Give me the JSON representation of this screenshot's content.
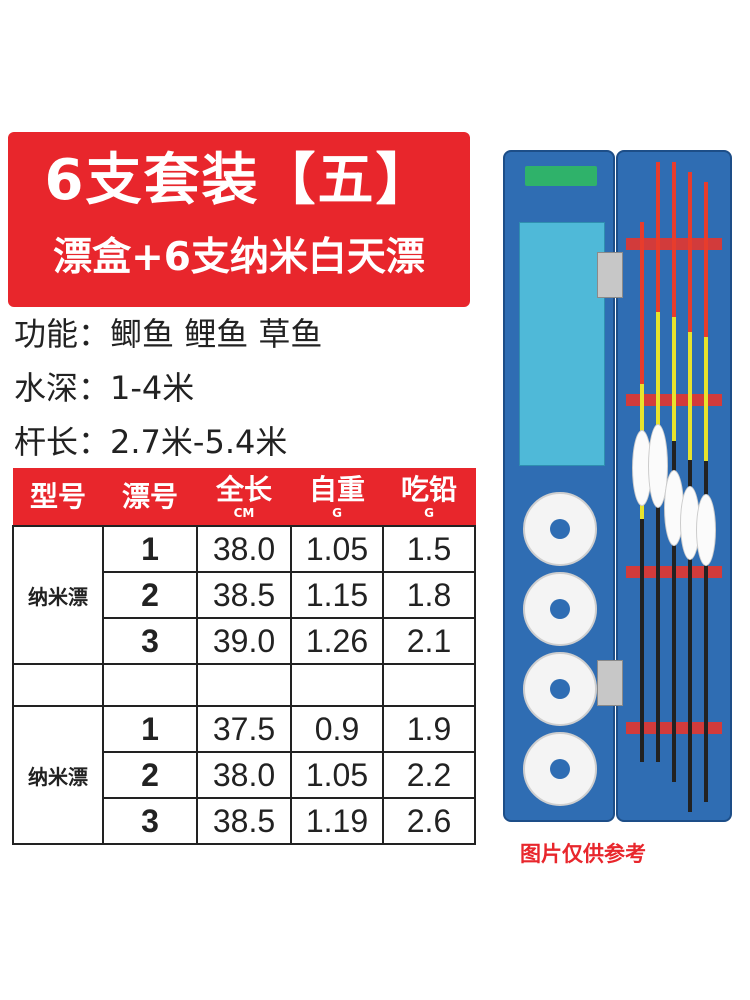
{
  "banner": {
    "line1": "6支套装【五】",
    "line2": "漂盒+6支纳米白天漂"
  },
  "specs": [
    {
      "label": "功能：",
      "value": "鲫鱼 鲤鱼 草鱼"
    },
    {
      "label": "水深：",
      "value": "1-4米"
    },
    {
      "label": "杆长：",
      "value": "2.7米-5.4米"
    }
  ],
  "table": {
    "headers": {
      "type": "型号",
      "index": "漂号",
      "length": "全长",
      "length_unit": "CM",
      "weight": "自重",
      "weight_unit": "G",
      "lead": "吃铅",
      "lead_unit": "G"
    },
    "groups": [
      {
        "type": "纳米漂",
        "rows": [
          {
            "index": "1",
            "length": "38.0",
            "weight": "1.05",
            "lead": "1.5"
          },
          {
            "index": "2",
            "length": "38.5",
            "weight": "1.15",
            "lead": "1.8"
          },
          {
            "index": "3",
            "length": "39.0",
            "weight": "1.26",
            "lead": "2.1"
          }
        ]
      },
      {
        "type": "纳米漂",
        "rows": [
          {
            "index": "1",
            "length": "37.5",
            "weight": "0.9",
            "lead": "1.9"
          },
          {
            "index": "2",
            "length": "38.0",
            "weight": "1.05",
            "lead": "2.2"
          },
          {
            "index": "3",
            "length": "38.5",
            "weight": "1.19",
            "lead": "2.6"
          }
        ]
      }
    ]
  },
  "note": "图片仅供参考",
  "colors": {
    "accent": "#e8262c",
    "box": "#2f6db3"
  }
}
